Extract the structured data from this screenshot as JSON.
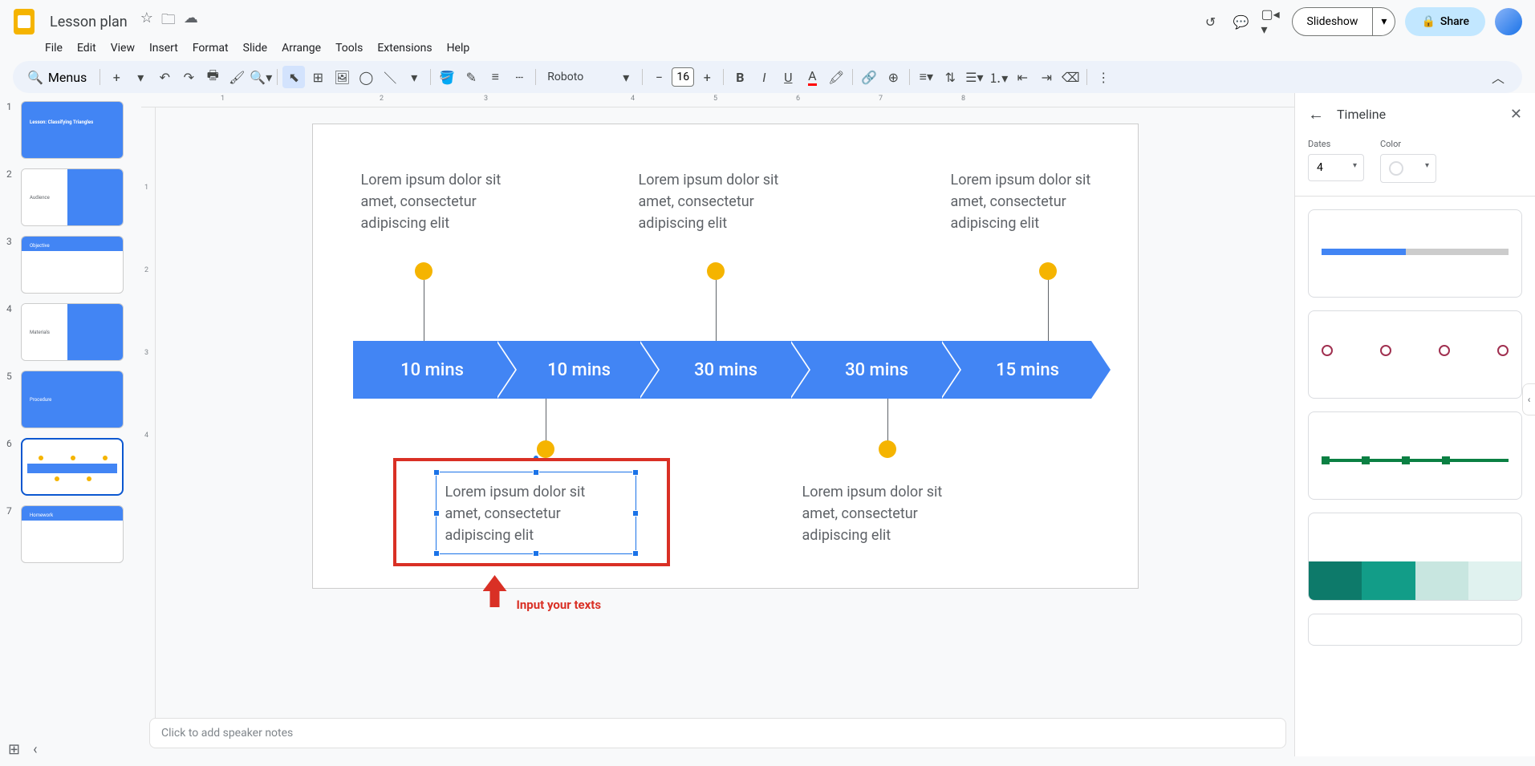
{
  "header": {
    "doc_title": "Lesson plan",
    "slideshow_label": "Slideshow",
    "share_label": "Share"
  },
  "menubar": {
    "file": "File",
    "edit": "Edit",
    "view": "View",
    "insert": "Insert",
    "format": "Format",
    "slide": "Slide",
    "arrange": "Arrange",
    "tools": "Tools",
    "extensions": "Extensions",
    "help": "Help"
  },
  "toolbar": {
    "search_label": "Menus",
    "font_name": "Roboto",
    "font_size": "16"
  },
  "filmstrip": [
    {
      "num": "1",
      "title": "Lesson: Classifying Triangles"
    },
    {
      "num": "2",
      "title": "Audience"
    },
    {
      "num": "3",
      "title": "Objective"
    },
    {
      "num": "4",
      "title": "Materials"
    },
    {
      "num": "5",
      "title": "Procedure"
    },
    {
      "num": "6",
      "title": ""
    },
    {
      "num": "7",
      "title": "Homework"
    }
  ],
  "slide": {
    "top_texts": [
      "Lorem ipsum dolor sit amet, consectetur adipiscing elit",
      "Lorem ipsum dolor sit amet, consectetur adipiscing elit",
      "Lorem ipsum dolor sit amet, consectetur adipiscing elit"
    ],
    "segments": [
      "10 mins",
      "10 mins",
      "30 mins",
      "30 mins",
      "15 mins"
    ],
    "bottom_texts": [
      "Lorem ipsum dolor sit amet, consectetur adipiscing elit",
      "Lorem ipsum dolor sit amet, consectetur adipiscing elit"
    ],
    "annotation": "Input your texts"
  },
  "speaker_notes": {
    "placeholder": "Click to add speaker notes"
  },
  "sidebar": {
    "title": "Timeline",
    "dates_label": "Dates",
    "dates_value": "4",
    "color_label": "Color"
  },
  "ruler_h": [
    "1",
    "2",
    "3",
    "4",
    "5",
    "6",
    "7",
    "8"
  ],
  "ruler_v": [
    "1",
    "2",
    "3",
    "4"
  ]
}
